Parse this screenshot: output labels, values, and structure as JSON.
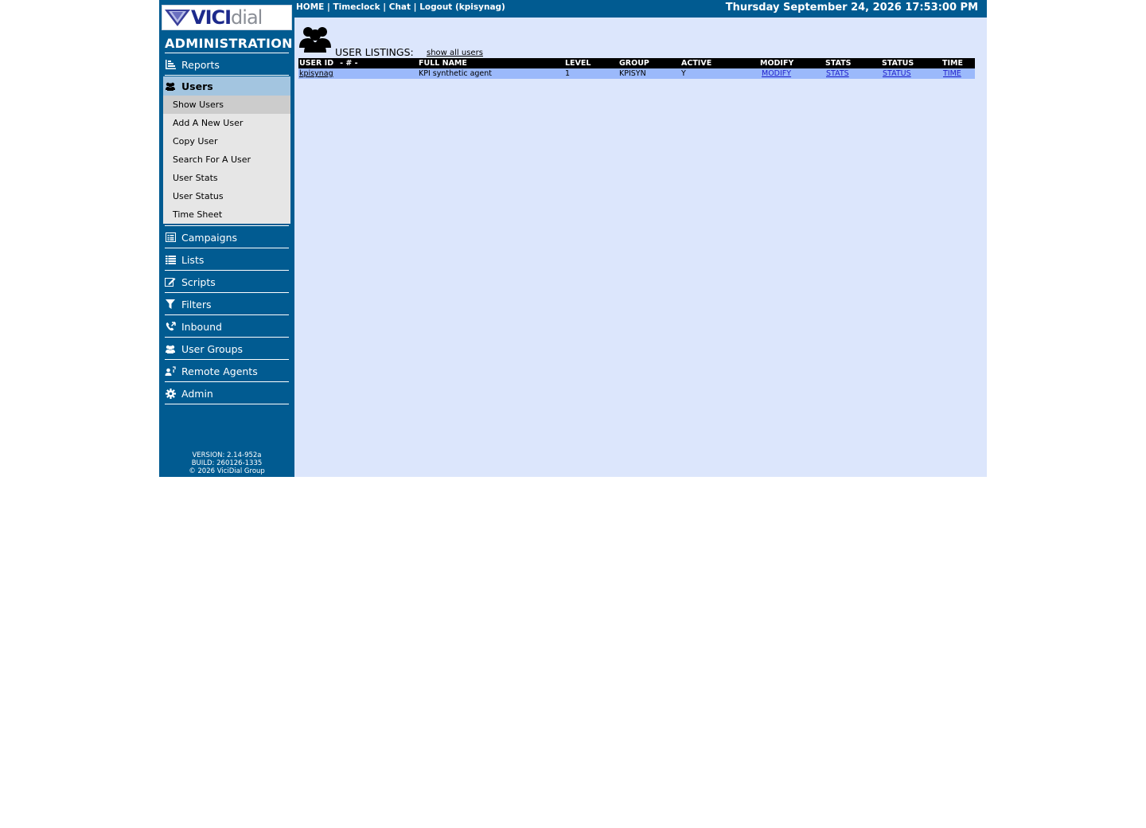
{
  "brand": {
    "logo_vici": "VICI",
    "logo_dial": "dial",
    "section_title": "ADMINISTRATION"
  },
  "sidebar": {
    "items": [
      {
        "label": "Reports",
        "icon": "reports-icon"
      },
      {
        "label": "Users",
        "icon": "users-icon",
        "active": true
      },
      {
        "label": "Campaigns",
        "icon": "campaigns-icon"
      },
      {
        "label": "Lists",
        "icon": "lists-icon"
      },
      {
        "label": "Scripts",
        "icon": "scripts-icon"
      },
      {
        "label": "Filters",
        "icon": "filter-icon"
      },
      {
        "label": "Inbound",
        "icon": "phone-icon"
      },
      {
        "label": "User Groups",
        "icon": "user-groups-icon"
      },
      {
        "label": "Remote Agents",
        "icon": "remote-agents-icon"
      },
      {
        "label": "Admin",
        "icon": "gear-icon"
      }
    ],
    "submenu": [
      {
        "label": "Show Users",
        "active": true
      },
      {
        "label": "Add A New User"
      },
      {
        "label": "Copy User"
      },
      {
        "label": "Search For A User"
      },
      {
        "label": "User Stats"
      },
      {
        "label": "User Status"
      },
      {
        "label": "Time Sheet"
      }
    ],
    "version": "VERSION: 2.14-952a",
    "build": "BUILD: 260126-1335",
    "copyright": "© 2026 ViciDial Group"
  },
  "header": {
    "home": "HOME",
    "timeclock": "Timeclock",
    "chat": "Chat",
    "logout": "Logout (kpisynag)",
    "separator": " | ",
    "datetime": "Thursday September 24, 2026 17:53:00 PM"
  },
  "main": {
    "title": "USER LISTINGS:",
    "show_all": "show all users",
    "columns": {
      "user_id": "USER ID",
      "sort": "- # -",
      "full_name": "FULL NAME",
      "level": "LEVEL",
      "group": "GROUP",
      "active": "ACTIVE",
      "modify": "MODIFY",
      "stats": "STATS",
      "status": "STATUS",
      "time": "TIME"
    },
    "rows": [
      {
        "user_id": "kpisynag",
        "full_name": "KPI synthetic agent",
        "level": "1",
        "group": "KPISYN",
        "active": "Y",
        "modify": "MODIFY",
        "stats": "STATS",
        "status": "STATUS",
        "time": "TIME"
      }
    ]
  },
  "colors": {
    "sidebar_bg": "#015b91",
    "main_bg": "#dce6fc",
    "row_bg": "#9bb9fb",
    "header_row_bg": "#000000",
    "active_nav_bg": "#a3c5e0",
    "submenu_bg": "#e6e6e6"
  }
}
